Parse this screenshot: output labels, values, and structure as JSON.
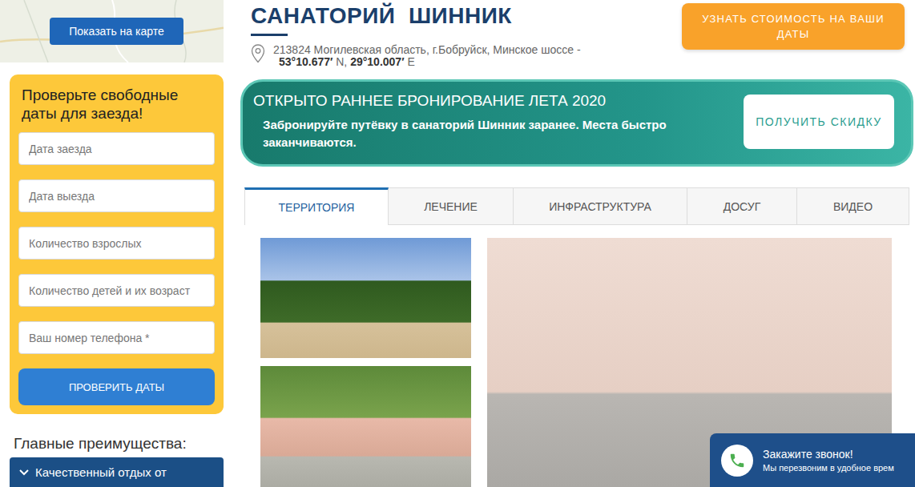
{
  "map": {
    "button": "Показать на карте"
  },
  "booking": {
    "title": "Проверьте свободные даты для заезда!",
    "fields": [
      {
        "placeholder": "Дата заезда"
      },
      {
        "placeholder": "Дата выезда"
      },
      {
        "placeholder": "Количество взрослых"
      },
      {
        "placeholder": "Количество детей и их возраст"
      },
      {
        "placeholder": "Ваш номер телефона *"
      }
    ],
    "button": "ПРОВЕРИТЬ ДАТЫ"
  },
  "advantages": {
    "title": "Главные преимущества:",
    "items": [
      {
        "label": "Качественный отдых от",
        "expanded": false
      }
    ]
  },
  "header": {
    "title": "САНАТОРИЙ  ШИННИК",
    "address": "213824 Могилевская область, г.Бобруйск, Минское шоссе -",
    "coords": {
      "lat": "53°10.677′",
      "lat_suffix": "N,",
      "lon": "29°10.007′",
      "lon_suffix": "E"
    },
    "price_button": "УЗНАТЬ СТОИМОСТЬ НА ВАШИ ДАТЫ"
  },
  "promo": {
    "title": "ОТКРЫТО РАННЕЕ БРОНИРОВАНИЕ ЛЕТА 2020",
    "text": "Забронируйте путёвку в санаторий Шинник заранее. Места быстро заканчиваются.",
    "button": "ПОЛУЧИТЬ СКИДКУ"
  },
  "tabs": [
    {
      "label": "ТЕРРИТОРИЯ",
      "selected": true
    },
    {
      "label": "ЛЕЧЕНИЕ",
      "selected": false
    },
    {
      "label": "ИНФРАСТРУКТУРА",
      "selected": false
    },
    {
      "label": "ДОСУГ",
      "selected": false
    },
    {
      "label": "ВИДЕО",
      "selected": false
    }
  ],
  "callback": {
    "title": "Закажите звонок!",
    "text": "Мы перезвоним в удобное врем"
  }
}
